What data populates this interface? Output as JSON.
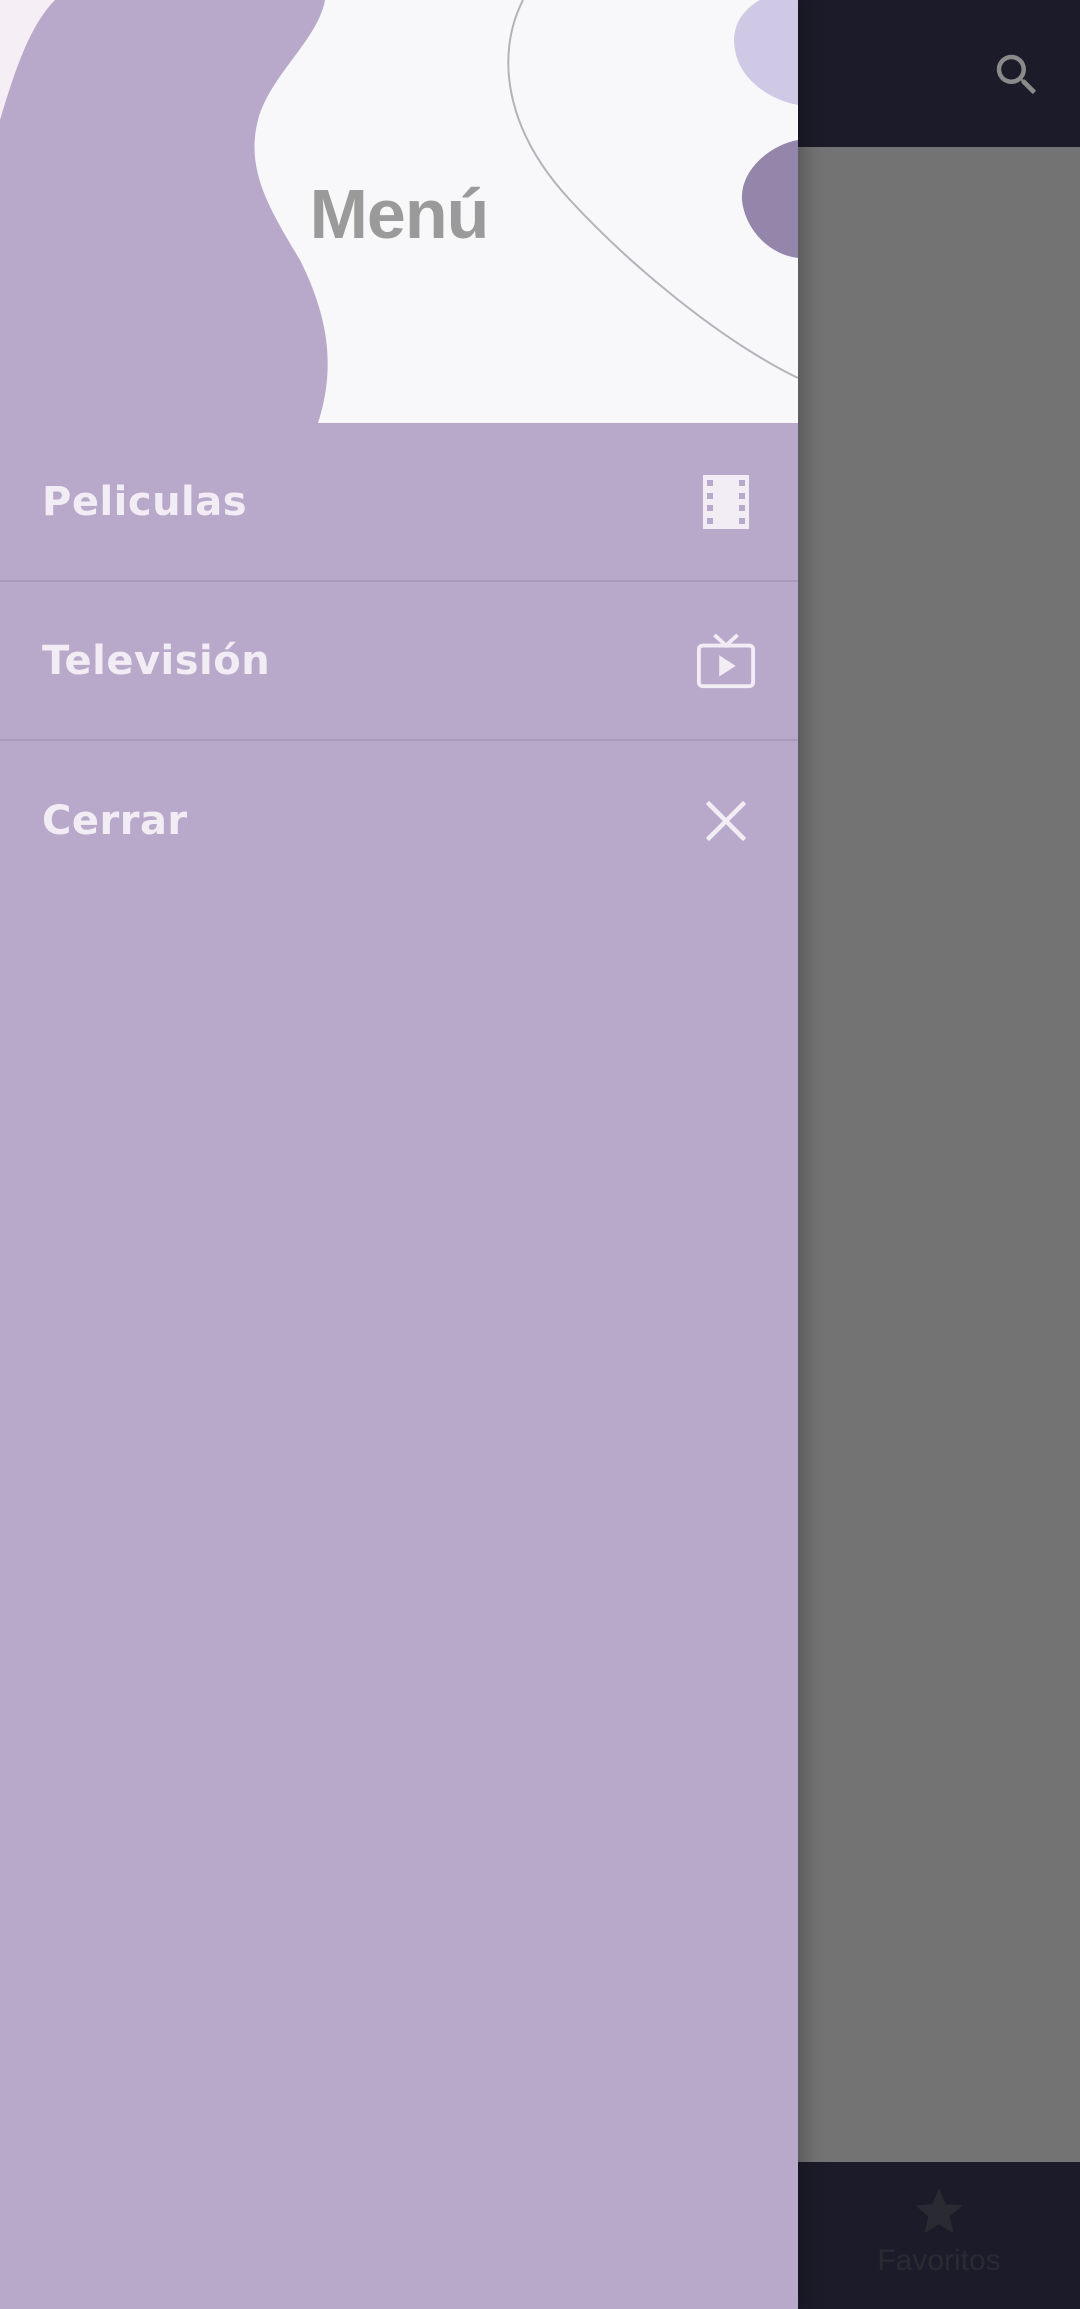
{
  "app": {
    "colors": {
      "drawer_bg": "#b8a9cb",
      "header_bg": "#f8f8fa",
      "bar_bg": "#1c1b29",
      "scrim": "#737373",
      "menu_text": "#f2ecf4",
      "title_text": "#9a9a9a"
    }
  },
  "topbar": {
    "search_icon": "search-icon"
  },
  "drawer": {
    "title": "Menú",
    "items": [
      {
        "label": "Peliculas",
        "icon": "movie-film-icon"
      },
      {
        "label": "Televisión",
        "icon": "live-tv-icon"
      },
      {
        "label": "Cerrar",
        "icon": "close-icon"
      }
    ]
  },
  "bottom_nav": {
    "favorites": {
      "label": "Favoritos",
      "icon": "star-icon"
    }
  }
}
